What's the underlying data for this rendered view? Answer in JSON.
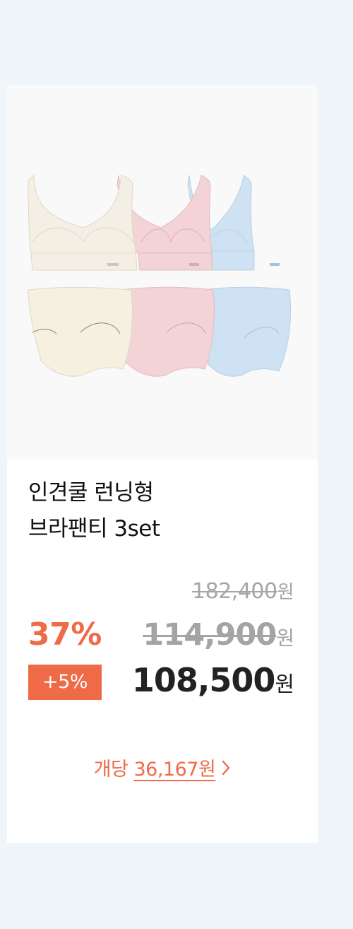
{
  "product": {
    "title_line1": "인견쿨 런닝형",
    "title_line2": "브라팬티 3set",
    "image_alt": "bra and panty set in cream, pink and sky blue"
  },
  "pricing": {
    "original_price": "182,400",
    "original_unit": "원",
    "discount_rate": "37%",
    "sale_price": "114,900",
    "sale_unit": "원",
    "extra_discount": "+5%",
    "final_price": "108,500",
    "final_unit": "원"
  },
  "per_unit": {
    "prefix": "개당",
    "amount": "36,167원",
    "icon": "chevron-right-icon"
  },
  "colors": {
    "background": "#f0f5fa",
    "accent": "#ef6a47",
    "strike": "#a6a6a6",
    "text": "#111111",
    "product_colors": [
      "#f4efe4",
      "#f3d3d6",
      "#cfe2f3"
    ]
  }
}
